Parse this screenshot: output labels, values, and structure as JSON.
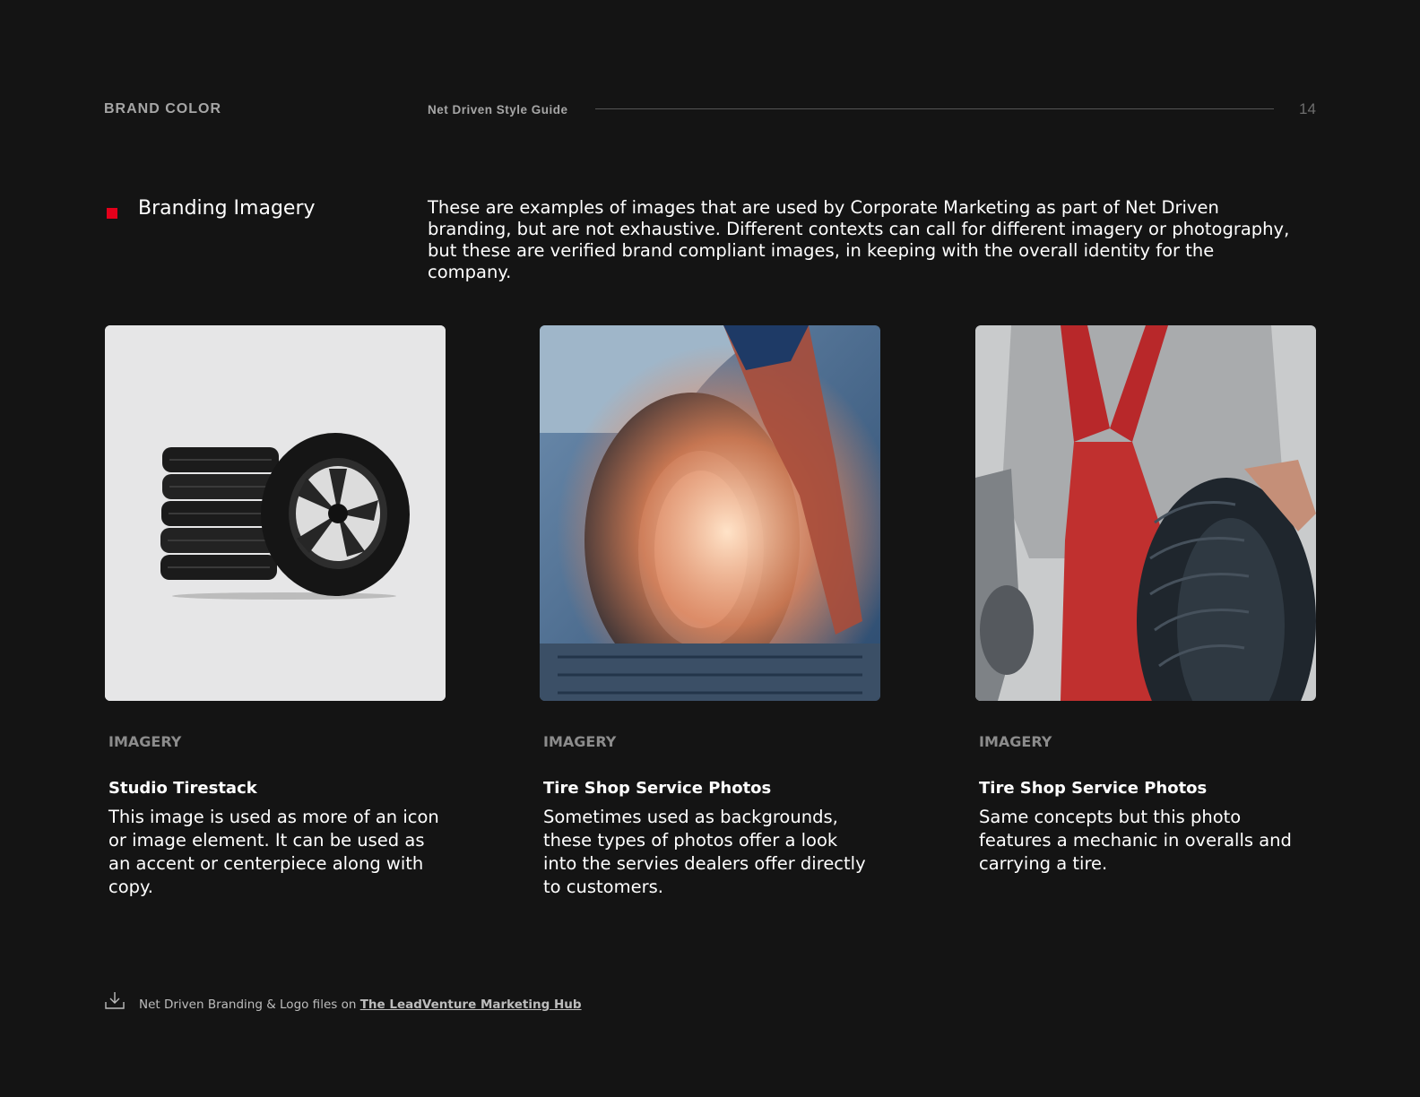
{
  "header": {
    "section_label": "BRAND COLOR",
    "guide_title": "Net Driven Style Guide",
    "page_number": "14"
  },
  "intro": {
    "heading": "Branding Imagery",
    "description": "These are examples of images that are used by Corporate Marketing as part of Net Driven branding, but are not exhaustive. Different contexts can call for different imagery or photography, but these are verified brand compliant images, in keeping with the overall identity for the company."
  },
  "colors": {
    "background": "#141414",
    "accent_red": "#e3001b"
  },
  "cards": [
    {
      "label": "IMAGERY",
      "title": "Studio Tirestack",
      "body": "This image is used as more of an icon or image element. It can be used as an accent or centerpiece along with copy.",
      "image": "tire-stack-photo"
    },
    {
      "label": "IMAGERY",
      "title": "Tire Shop Service Photos",
      "body": "Sometimes used as backgrounds, these types of photos offer a look into the servies dealers offer directly to customers.",
      "image": "mechanic-changing-tire-photo"
    },
    {
      "label": "IMAGERY",
      "title": "Tire Shop Service Photos",
      "body": "Same concepts but this photo features a mechanic in overalls and carrying a tire.",
      "image": "mechanic-overalls-carrying-tire-photo"
    }
  ],
  "footer": {
    "icon": "download-icon",
    "text": "Net Driven Branding & Logo files on ",
    "link_text": "The LeadVenture Marketing Hub"
  }
}
